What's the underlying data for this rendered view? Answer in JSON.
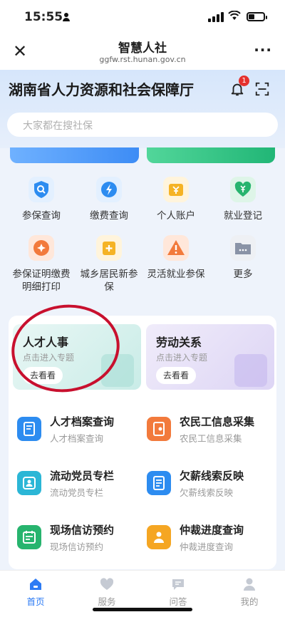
{
  "status": {
    "time": "15:55"
  },
  "nav": {
    "title": "智慧人社",
    "subtitle": "ggfw.rst.hunan.gov.cn"
  },
  "header": {
    "org_name": "湖南省人力资源和社会保障厅",
    "notification_count": "1"
  },
  "search": {
    "placeholder": "大家都在搜社保"
  },
  "grid": {
    "items": [
      {
        "label": "参保查询",
        "icon": "shield-search-icon",
        "color": "#2d8cf0"
      },
      {
        "label": "缴费查询",
        "icon": "lightning-icon",
        "color": "#2d8cf0"
      },
      {
        "label": "个人账户",
        "icon": "wallet-icon",
        "color": "#f5b325"
      },
      {
        "label": "就业登记",
        "icon": "heart-yen-icon",
        "color": "#27b46e"
      },
      {
        "label": "参保证明缴费明细打印",
        "icon": "badge-icon",
        "color": "#f27a3c"
      },
      {
        "label": "城乡居民新参保",
        "icon": "plus-bag-icon",
        "color": "#f5b325"
      },
      {
        "label": "灵活就业参保",
        "icon": "warning-icon",
        "color": "#f27a3c"
      },
      {
        "label": "更多",
        "icon": "folder-icon",
        "color": "#8a93a6"
      }
    ]
  },
  "topics": [
    {
      "title": "人才人事",
      "subtitle": "点击进入专题",
      "button": "去看看"
    },
    {
      "title": "劳动关系",
      "subtitle": "点击进入专题",
      "button": "去看看"
    }
  ],
  "services": [
    {
      "name": "人才档案查询",
      "desc": "人才档案查询",
      "icon": "archive-icon",
      "color": "#2d8cf0"
    },
    {
      "name": "农民工信息采集",
      "desc": "农民工信息采集",
      "icon": "book-icon",
      "color": "#f27a3c"
    },
    {
      "name": "流动党员专栏",
      "desc": "流动党员专栏",
      "icon": "member-icon",
      "color": "#2bb6d6"
    },
    {
      "name": "欠薪线索反映",
      "desc": "欠薪线索反映",
      "icon": "document-icon",
      "color": "#2d8cf0"
    },
    {
      "name": "现场信访预约",
      "desc": "现场信访预约",
      "icon": "calendar-icon",
      "color": "#27b46e"
    },
    {
      "name": "仲裁进度查询",
      "desc": "仲裁进度查询",
      "icon": "person-card-icon",
      "color": "#f5a623"
    }
  ],
  "tabs": [
    {
      "label": "首页",
      "icon": "home-icon"
    },
    {
      "label": "服务",
      "icon": "heart-icon"
    },
    {
      "label": "问答",
      "icon": "chat-icon"
    },
    {
      "label": "我的",
      "icon": "user-icon"
    }
  ],
  "colors": {
    "accent": "#2d7bf4",
    "annotation": "#c8102e"
  }
}
